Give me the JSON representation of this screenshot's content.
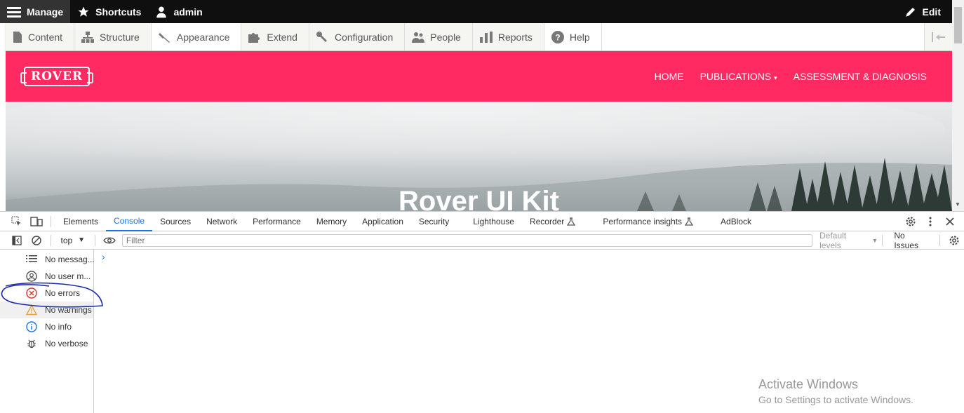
{
  "admin_toolbar": {
    "manage": "Manage",
    "shortcuts": "Shortcuts",
    "user": "admin",
    "edit": "Edit"
  },
  "admin_tray": [
    {
      "label": "Content",
      "icon": "file-icon"
    },
    {
      "label": "Structure",
      "icon": "sitemap-icon"
    },
    {
      "label": "Appearance",
      "icon": "paintbrush-icon"
    },
    {
      "label": "Extend",
      "icon": "puzzle-icon"
    },
    {
      "label": "Configuration",
      "icon": "wrench-icon"
    },
    {
      "label": "People",
      "icon": "people-icon"
    },
    {
      "label": "Reports",
      "icon": "bar-chart-icon"
    },
    {
      "label": "Help",
      "icon": "help-icon"
    }
  ],
  "site": {
    "logo": "ROVER",
    "nav": [
      "HOME",
      "PUBLICATIONS",
      "ASSESSMENT & DIAGNOSIS"
    ],
    "hero_title": "Rover UI Kit",
    "brand_color": "#ff2a62"
  },
  "devtools": {
    "tabs": [
      "Elements",
      "Console",
      "Sources",
      "Network",
      "Performance",
      "Memory",
      "Application",
      "Security",
      "Lighthouse",
      "Recorder",
      "Performance insights",
      "AdBlock"
    ],
    "active_tab": "Console",
    "context": "top",
    "filter_placeholder": "Filter",
    "default_levels": "Default levels",
    "issues": "No Issues",
    "sidebar": [
      {
        "label": "No messag...",
        "icon": "list-icon"
      },
      {
        "label": "No user m...",
        "icon": "user-circle-icon"
      },
      {
        "label": "No errors",
        "icon": "error-icon"
      },
      {
        "label": "No warnings",
        "icon": "warning-icon"
      },
      {
        "label": "No info",
        "icon": "info-icon"
      },
      {
        "label": "No verbose",
        "icon": "bug-icon"
      }
    ],
    "accent_color": "#1a73e8"
  },
  "watermark": {
    "line1": "Activate Windows",
    "line2": "Go to Settings to activate Windows."
  }
}
